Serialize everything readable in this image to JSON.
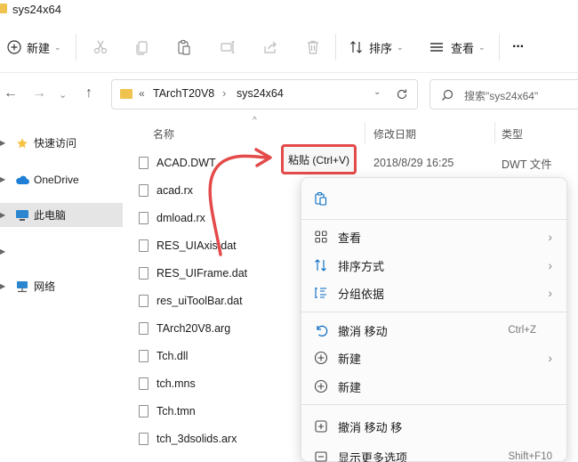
{
  "window": {
    "title": "sys24x64"
  },
  "toolbar": {
    "new_label": "新建",
    "sort_label": "排序",
    "view_label": "查看",
    "more_label": "···"
  },
  "address": {
    "overflow": "«",
    "crumbs": [
      "TArchT20V8",
      "sys24x64"
    ],
    "search_placeholder": "搜索\"sys24x64\""
  },
  "sidebar": {
    "items": [
      {
        "label": "快速访问",
        "icon": "star-icon"
      },
      {
        "label": "OneDrive",
        "icon": "cloud-icon"
      },
      {
        "label": "此电脑",
        "icon": "pc-icon"
      },
      {
        "label": "网络",
        "icon": "network-icon"
      }
    ]
  },
  "columns": {
    "name": "名称",
    "date": "修改日期",
    "type": "类型"
  },
  "files": [
    {
      "name": "ACAD.DWT",
      "date": "2018/8/29 16:25",
      "type": "DWT 文件"
    },
    {
      "name": "acad.rx"
    },
    {
      "name": "dmload.rx"
    },
    {
      "name": "RES_UIAxis.dat"
    },
    {
      "name": "RES_UIFrame.dat"
    },
    {
      "name": "res_uiToolBar.dat"
    },
    {
      "name": "TArch20V8.arg"
    },
    {
      "name": "Tch.dll"
    },
    {
      "name": "tch.mns"
    },
    {
      "name": "Tch.tmn"
    },
    {
      "name": "tch_3dsolids.arx"
    }
  ],
  "tooltip": {
    "text": "粘贴 (Ctrl+V)"
  },
  "context_menu": {
    "items": [
      {
        "label": "查看",
        "icon": "grid-icon",
        "submenu": true
      },
      {
        "label": "排序方式",
        "icon": "sort-icon",
        "submenu": true
      },
      {
        "label": "分组依据",
        "icon": "group-icon",
        "submenu": true
      },
      {
        "label": "撤消 移动",
        "icon": "undo-icon",
        "shortcut": "Ctrl+Z"
      },
      {
        "label": "新建",
        "icon": "new-icon",
        "submenu": true
      },
      {
        "label": "新建",
        "icon": "new-icon"
      },
      {
        "label": "撤消 移动 移",
        "icon": "new-icon"
      },
      {
        "label": "显示更多选项",
        "icon": "more-options-icon",
        "shortcut": "Shift+F10"
      }
    ]
  },
  "colors": {
    "accent": "#0067c0",
    "highlight": "#e44a4a",
    "folder": "#f0c34e"
  }
}
